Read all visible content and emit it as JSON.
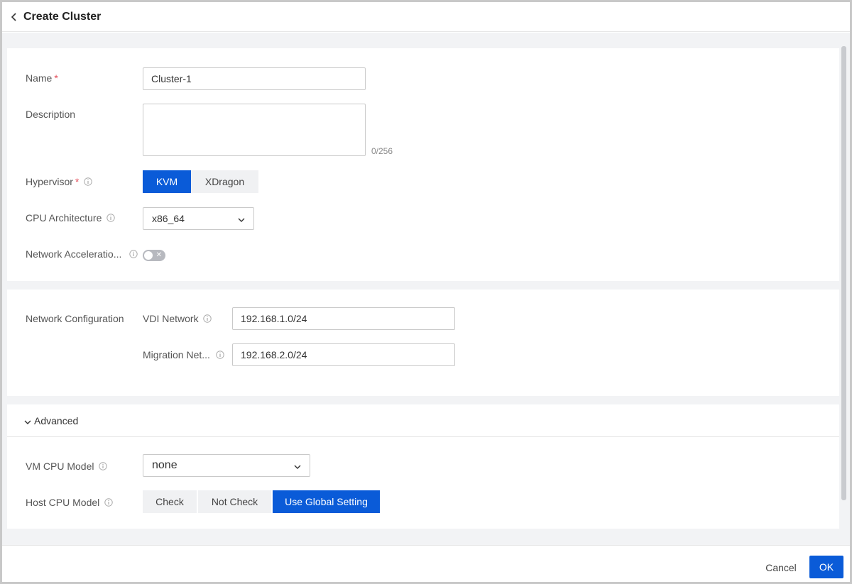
{
  "header": {
    "title": "Create Cluster"
  },
  "basic": {
    "name_label": "Name",
    "name_value": "Cluster-1",
    "description_label": "Description",
    "description_value": "",
    "description_counter": "0/256",
    "hypervisor_label": "Hypervisor",
    "hypervisor_options": [
      "KVM",
      "XDragon"
    ],
    "hypervisor_selected": "KVM",
    "cpu_arch_label": "CPU Architecture",
    "cpu_arch_value": "x86_64",
    "net_accel_label": "Network Acceleratio...",
    "net_accel_enabled": false,
    "required_mark": "*"
  },
  "network": {
    "section_label": "Network Configuration",
    "vdi_label": "VDI Network",
    "vdi_value": "192.168.1.0/24",
    "migration_label": "Migration Net...",
    "migration_value": "192.168.2.0/24"
  },
  "advanced": {
    "toggle_label": "Advanced",
    "vm_cpu_model_label": "VM CPU Model",
    "vm_cpu_model_value": "none",
    "host_cpu_model_label": "Host CPU Model",
    "host_cpu_options": [
      "Check",
      "Not Check",
      "Use Global Setting"
    ],
    "host_cpu_selected": "Use Global Setting"
  },
  "footer": {
    "cancel_label": "Cancel",
    "ok_label": "OK"
  },
  "colors": {
    "primary": "#0a5bd8",
    "required": "#e34d59",
    "page_bg": "#f2f3f5"
  }
}
